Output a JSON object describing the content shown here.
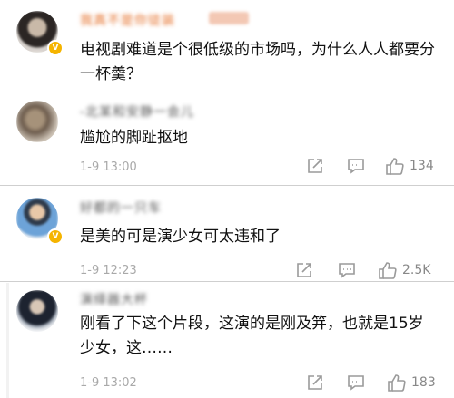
{
  "comments": [
    {
      "username": "我真不是你徒装",
      "text": "电视剧难道是个很低级的市场吗，为什么人人都要分一杯羹？",
      "timestamp": "",
      "likes": ""
    },
    {
      "username": "-北某和安静一会儿",
      "text": "尴尬的脚趾抠地",
      "timestamp": "1-9 13:00",
      "likes": "134"
    },
    {
      "username": "好都的一只车",
      "text": "是美的可是演少女可太违和了",
      "timestamp": "1-9 12:23",
      "likes": "2.5K"
    },
    {
      "username": "演绎器大杯",
      "text": "刚看了下这个片段，这演的是刚及笄，也就是15岁少女，这……",
      "timestamp": "1-9 13:02",
      "likes": "183"
    }
  ],
  "icons": {
    "share": "share-icon",
    "comment": "comment-icon",
    "like": "thumbs-up-icon",
    "verified": "verified-v-icon"
  },
  "colors": {
    "username_orange": "#e5702a",
    "verified_badge": "#f5b400",
    "meta_gray": "#a9a9a9"
  }
}
